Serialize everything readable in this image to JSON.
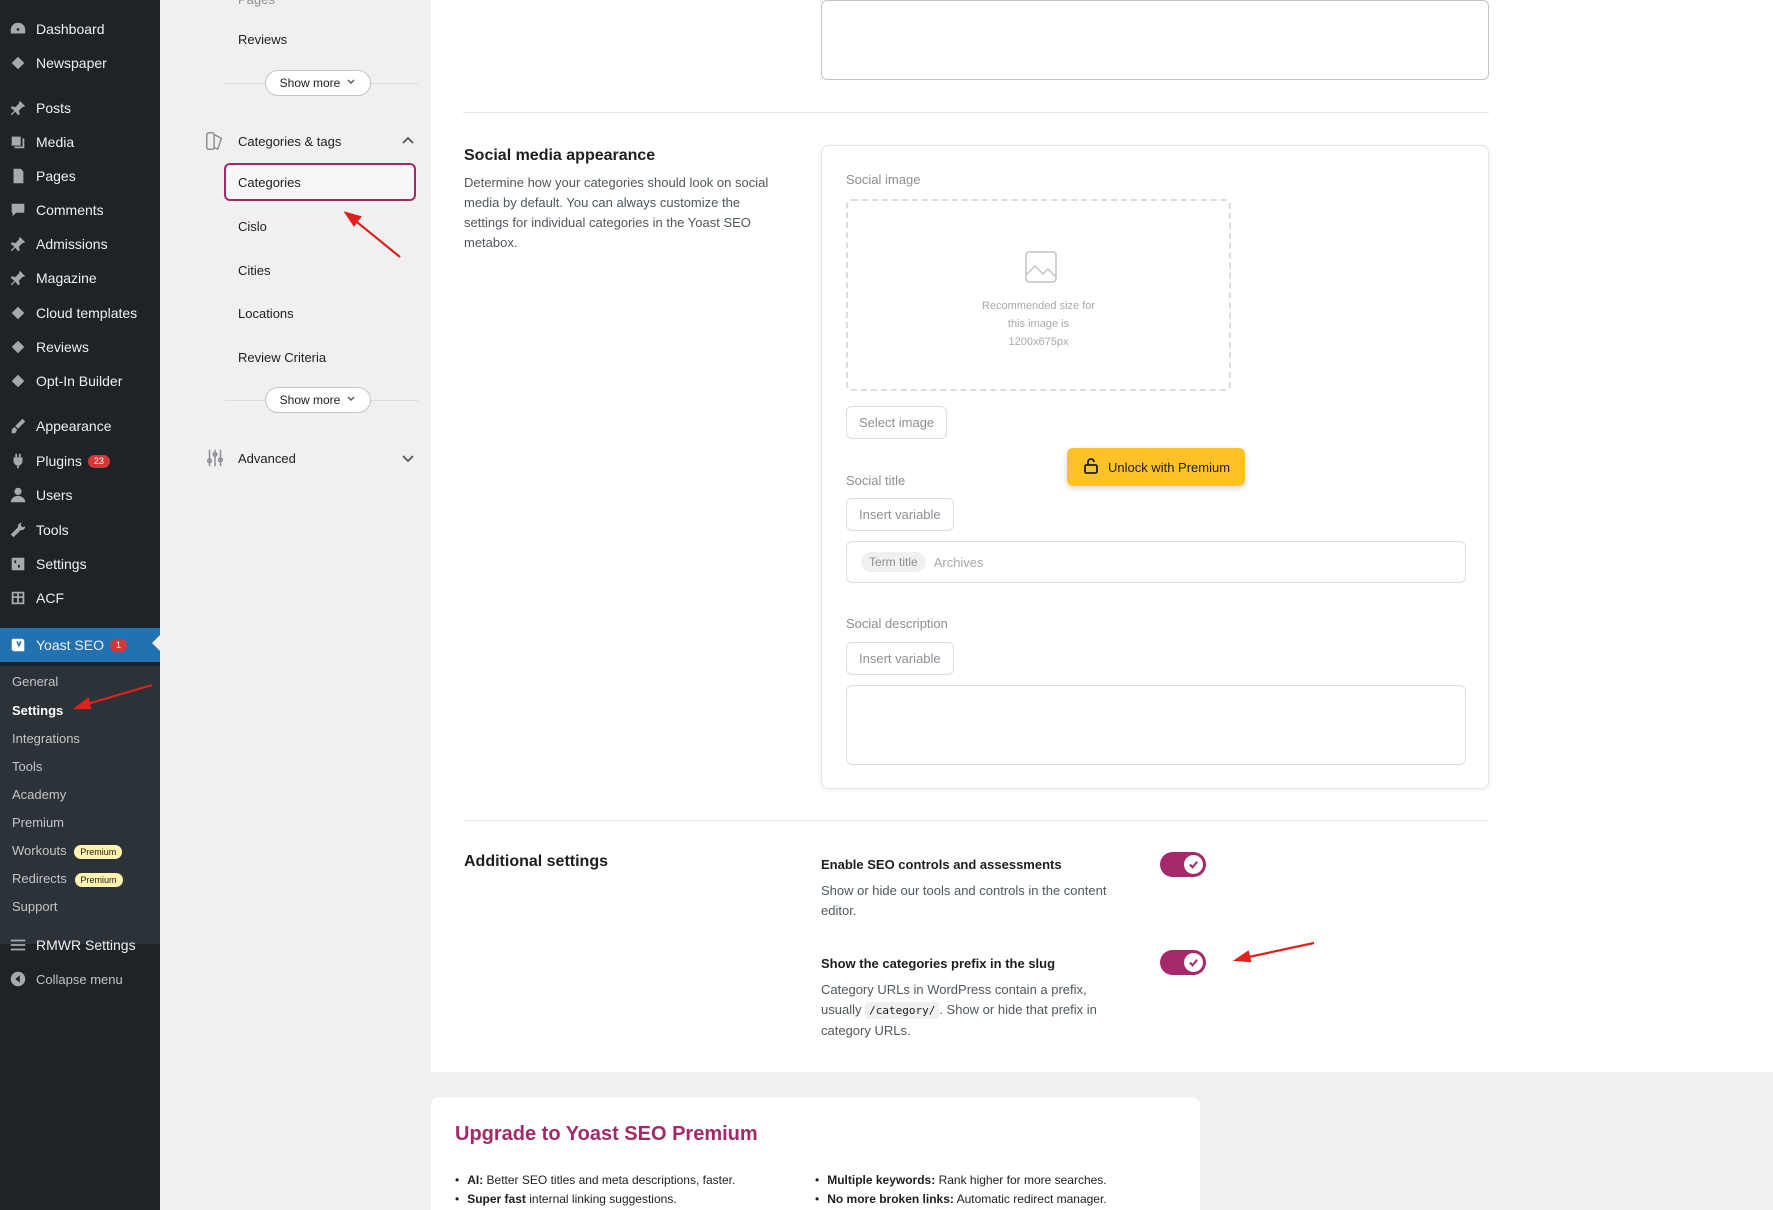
{
  "wp_menu": {
    "items": [
      {
        "label": "Dashboard",
        "icon": "dashboard-icon"
      },
      {
        "label": "Newspaper",
        "icon": "newspaper-icon"
      },
      {
        "label": "Posts",
        "icon": "pin-icon"
      },
      {
        "label": "Media",
        "icon": "media-icon"
      },
      {
        "label": "Pages",
        "icon": "pages-icon"
      },
      {
        "label": "Comments",
        "icon": "comments-icon"
      },
      {
        "label": "Admissions",
        "icon": "pin-icon"
      },
      {
        "label": "Magazine",
        "icon": "pin-icon"
      },
      {
        "label": "Cloud templates",
        "icon": "diamond-icon"
      },
      {
        "label": "Reviews",
        "icon": "diamond-icon"
      },
      {
        "label": "Opt-In Builder",
        "icon": "diamond-icon"
      },
      {
        "label": "Appearance",
        "icon": "brush-icon"
      },
      {
        "label": "Plugins",
        "icon": "plug-icon",
        "badge": "23"
      },
      {
        "label": "Users",
        "icon": "user-icon"
      },
      {
        "label": "Tools",
        "icon": "wrench-icon"
      },
      {
        "label": "Settings",
        "icon": "settings-icon"
      },
      {
        "label": "ACF",
        "icon": "grid-icon"
      },
      {
        "label": "Yoast SEO",
        "icon": "yoast-icon",
        "badge": "1"
      }
    ],
    "yoast_sub": [
      "General",
      "Settings",
      "Integrations",
      "Tools",
      "Academy",
      "Premium",
      "Workouts",
      "Redirects",
      "Support"
    ],
    "premium_pill": "Premium",
    "rmwr": "RMWR Settings",
    "collapse": "Collapse menu"
  },
  "settings_nav": {
    "reviews": "Reviews",
    "show_more": "Show more",
    "group_categories": "Categories & tags",
    "active": "Categories",
    "links": [
      "Cislo",
      "Cities",
      "Locations",
      "Review Criteria"
    ],
    "group_advanced": "Advanced"
  },
  "social": {
    "title": "Social media appearance",
    "desc": "Determine how your categories should look on social media by default. You can always customize the settings for individual categories in the Yoast SEO metabox.",
    "image_label": "Social image",
    "image_hint": "Recommended size for\nthis image is\n1200x675px",
    "select_image": "Select image",
    "unlock": "Unlock with Premium",
    "title_label": "Social title",
    "insert_variable": "Insert variable",
    "chip": "Term title",
    "chip_after": "Archives",
    "desc_label": "Social description"
  },
  "additional": {
    "title": "Additional settings",
    "s1_title": "Enable SEO controls and assessments",
    "s1_desc": "Show or hide our tools and controls in the content editor.",
    "s2_title": "Show the categories prefix in the slug",
    "s2_desc_a": "Category URLs in WordPress contain a prefix, usually",
    "s2_code": "/category/",
    "s2_desc_b": ". Show or hide that prefix in category URLs."
  },
  "upgrade": {
    "title": "Upgrade to Yoast SEO Premium",
    "left": [
      {
        "bold": "AI:",
        "rest": " Better SEO titles and meta descriptions, faster."
      },
      {
        "bold": "Super fast",
        "rest": " internal linking suggestions."
      }
    ],
    "right": [
      {
        "bold": "Multiple keywords:",
        "rest": " Rank higher for more searches."
      },
      {
        "bold": "No more broken links:",
        "rest": " Automatic redirect manager."
      }
    ]
  },
  "colors": {
    "accent": "#a4286a",
    "wp_sidebar": "#1d2327",
    "wp_active": "#2271b1",
    "unlock": "#fec228"
  }
}
